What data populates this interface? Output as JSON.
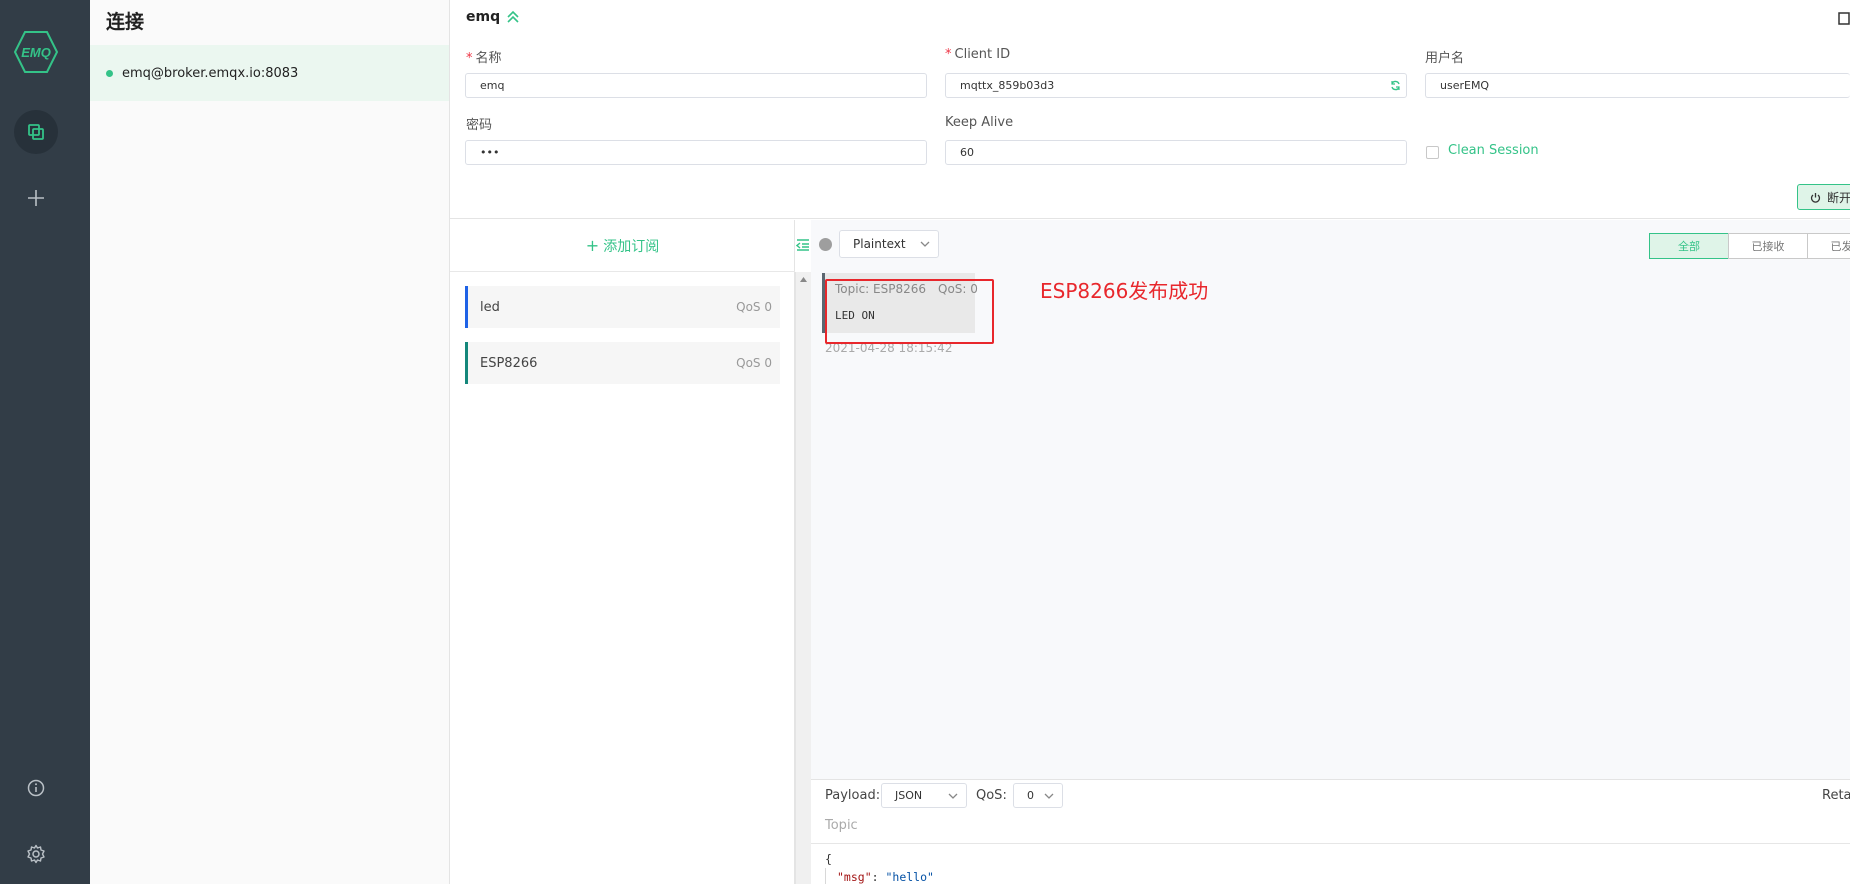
{
  "rail": {
    "logo_text": "EMQ",
    "items": [
      "connections",
      "new-connection",
      "about",
      "settings"
    ]
  },
  "connections": {
    "title": "连接",
    "items": [
      {
        "name": "emq@broker.emqx.io:8083",
        "status_color": "#34c388"
      }
    ]
  },
  "header": {
    "name": "emq",
    "fields": {
      "name_label": "名称",
      "name_value": "emq",
      "client_id_label": "Client ID",
      "client_id_value": "mqttx_859b03d3",
      "username_label": "用户名",
      "username_value": "userEMQ",
      "password_label": "密码",
      "password_value": "•••",
      "keepalive_label": "Keep Alive",
      "keepalive_value": "60",
      "clean_session_label": "Clean Session"
    },
    "disconnect_label": "断开"
  },
  "subscriptions": {
    "add_label": "添加订阅",
    "items": [
      {
        "topic": "led",
        "qos": "QoS 0",
        "color": "#1e62e6"
      },
      {
        "topic": "ESP8266",
        "qos": "QoS 0",
        "color": "#14877b"
      }
    ]
  },
  "messages": {
    "format": "Plaintext",
    "filters": [
      "全部",
      "已接收",
      "已发送"
    ],
    "items": [
      {
        "topic": "Topic: ESP8266",
        "qos": "QoS: 0",
        "payload": "LED ON",
        "time": "2021-04-28 18:15:42"
      }
    ],
    "annotation": "ESP8266发布成功"
  },
  "publish": {
    "payload_label": "Payload:",
    "payload_format": "JSON",
    "qos_label": "QoS:",
    "qos_value": "0",
    "retain_label": "Retain",
    "topic_placeholder": "Topic",
    "editor_line1": "{",
    "editor_key": "\"msg\"",
    "editor_colon": ": ",
    "editor_value": "\"hello\""
  },
  "colors": {
    "accent": "#34c388",
    "rail_bg": "#323d47",
    "annotation": "#e8272c"
  }
}
